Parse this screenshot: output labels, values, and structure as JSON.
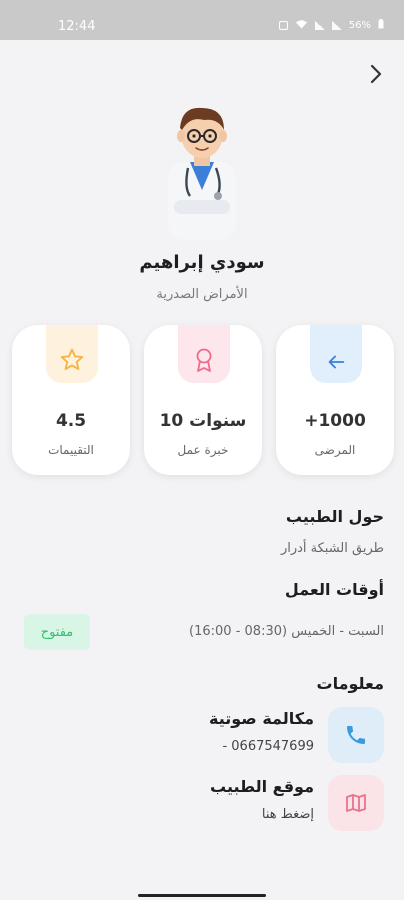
{
  "status_bar": {
    "time": "12:44",
    "battery": "56%"
  },
  "doctor": {
    "name": "سودي إبراهيم",
    "specialty": "الأمراض الصدرية"
  },
  "stats": [
    {
      "value": "4.5",
      "label": "التقييمات",
      "icon": "star-icon",
      "color": "#f5b547",
      "bg": "#fef1dd"
    },
    {
      "value": "10 سنوات",
      "label": "خبرة عمل",
      "icon": "award-icon",
      "color": "#f06a8a",
      "bg": "#fde6ec"
    },
    {
      "value": "+1000",
      "label": "المرضى",
      "icon": "arrow-left-icon",
      "color": "#3b7fd6",
      "bg": "#e1eefc"
    }
  ],
  "about": {
    "title": "حول الطبيب",
    "text": "طريق الشبكة أدرار"
  },
  "hours": {
    "title": "أوقات العمل",
    "text": "السبت - الخميس (08:30 - 16:00)",
    "status": "مفتوح"
  },
  "info": {
    "title": "معلومات",
    "call": {
      "title": "مكالمة صوتية",
      "sub": "0667547699  -"
    },
    "location": {
      "title": "موقع الطبيب",
      "sub": "إضغط هنا"
    }
  },
  "colors": {
    "accent": "#3b7fd6",
    "open_green": "#2ec06f"
  }
}
